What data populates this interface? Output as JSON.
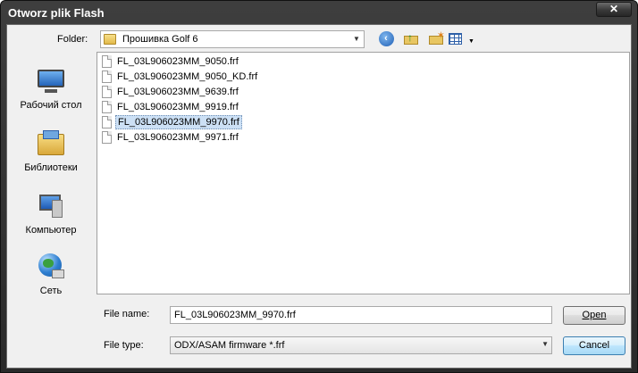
{
  "window": {
    "title": "Otworz plik Flash",
    "close_glyph": "✕"
  },
  "toolbar": {
    "folder_label": "Folder:",
    "folder_value": "Прошивка Golf 6",
    "icons": [
      "back-icon",
      "up-folder-icon",
      "new-folder-icon",
      "views-menu-icon"
    ]
  },
  "places": [
    {
      "label": "Рабочий стол",
      "icon": "desktop-icon"
    },
    {
      "label": "Библиотеки",
      "icon": "libraries-icon"
    },
    {
      "label": "Компьютер",
      "icon": "computer-icon"
    },
    {
      "label": "Сеть",
      "icon": "network-icon"
    }
  ],
  "files": [
    {
      "name": "FL_03L906023MM_9050.frf",
      "selected": false
    },
    {
      "name": "FL_03L906023MM_9050_KD.frf",
      "selected": false
    },
    {
      "name": "FL_03L906023MM_9639.frf",
      "selected": false
    },
    {
      "name": "FL_03L906023MM_9919.frf",
      "selected": false
    },
    {
      "name": "FL_03L906023MM_9970.frf",
      "selected": true
    },
    {
      "name": "FL_03L906023MM_9971.frf",
      "selected": false
    }
  ],
  "file_name": {
    "label": "File name:",
    "value": "FL_03L906023MM_9970.frf"
  },
  "file_type": {
    "label": "File type:",
    "value": "ODX/ASAM firmware *.frf"
  },
  "buttons": {
    "open": "Open",
    "cancel": "Cancel"
  },
  "colors": {
    "titlebar": "#2f2f2f",
    "selection": "#cce0f5",
    "dialog_bg": "#f0f0f0"
  }
}
